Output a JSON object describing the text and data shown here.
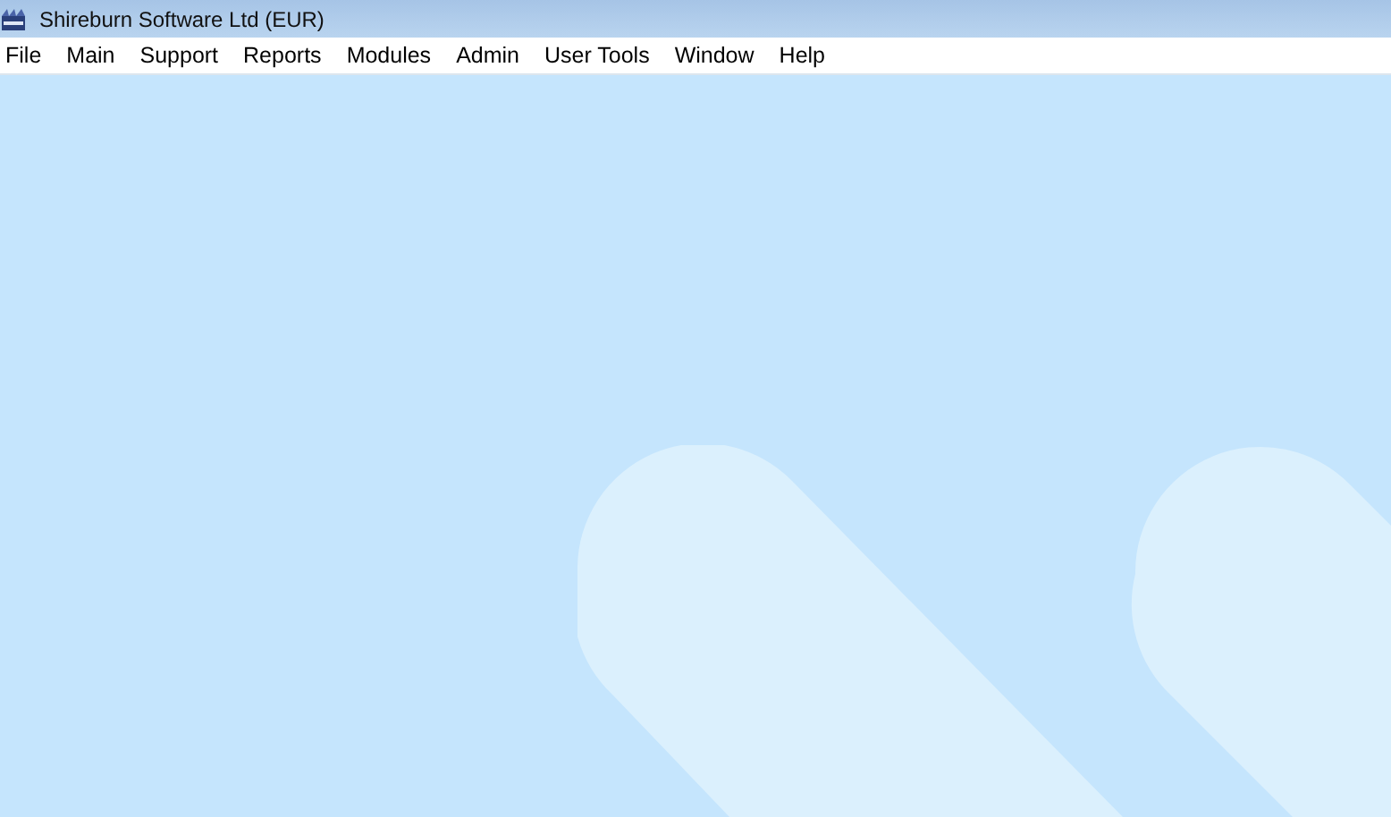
{
  "window": {
    "title": "Shireburn Software Ltd (EUR)"
  },
  "menu": [
    {
      "label": "File"
    },
    {
      "label": "Main"
    },
    {
      "label": "Support"
    },
    {
      "label": "Reports"
    },
    {
      "label": "Modules"
    },
    {
      "label": "Admin"
    },
    {
      "label": "User Tools"
    },
    {
      "label": "Window"
    },
    {
      "label": "Help"
    }
  ]
}
